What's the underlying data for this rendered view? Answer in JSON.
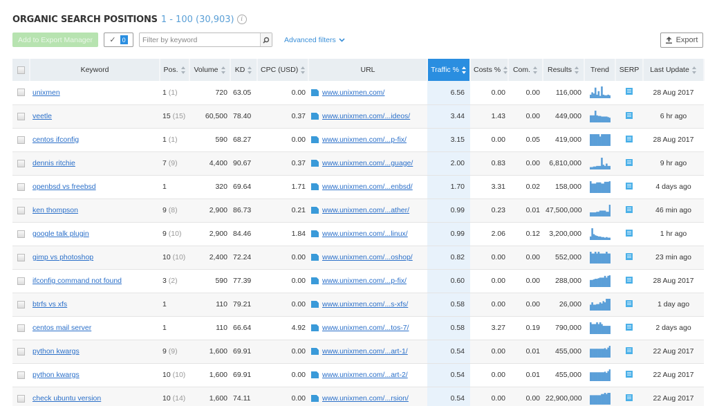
{
  "header": {
    "title": "ORGANIC SEARCH POSITIONS",
    "range": "1 - 100 (30,903)",
    "info_icon": "info-icon"
  },
  "toolbar": {
    "add_export_label": "Add to Export Manager",
    "selected_count": "0",
    "filter_placeholder": "Filter by keyword",
    "filter_value": "",
    "advanced_filters_label": "Advanced filters",
    "export_label": "Export"
  },
  "colors": {
    "accent": "#2a8ee0",
    "link": "#2a6fc9",
    "export_manager_btn": "#b7e3b0",
    "header_bg": "#e9eef2",
    "traffic_highlight": "#e8f2fb",
    "trend_bar": "#5b9fd8"
  },
  "columns": [
    {
      "key": "keyword",
      "label": "Keyword",
      "sortable": false
    },
    {
      "key": "pos",
      "label": "Pos.",
      "sortable": true
    },
    {
      "key": "volume",
      "label": "Volume",
      "sortable": true
    },
    {
      "key": "kd",
      "label": "KD",
      "sortable": true
    },
    {
      "key": "cpc",
      "label": "CPC (USD)",
      "sortable": true
    },
    {
      "key": "url",
      "label": "URL",
      "sortable": false
    },
    {
      "key": "traffic",
      "label": "Traffic %",
      "sortable": true,
      "active": true
    },
    {
      "key": "costs",
      "label": "Costs %",
      "sortable": true
    },
    {
      "key": "com",
      "label": "Com.",
      "sortable": true
    },
    {
      "key": "results",
      "label": "Results",
      "sortable": true
    },
    {
      "key": "trend",
      "label": "Trend",
      "sortable": false
    },
    {
      "key": "serp",
      "label": "SERP",
      "sortable": false
    },
    {
      "key": "last_update",
      "label": "Last Update",
      "sortable": true
    }
  ],
  "rows": [
    {
      "keyword": "unixmen",
      "pos": "1",
      "pos_prev": "(1)",
      "volume": "720",
      "kd": "63.05",
      "cpc": "0.00",
      "url": "www.unixmen.com/",
      "traffic": "6.56",
      "costs": "0.00",
      "com": "0.00",
      "results": "116,000",
      "last_update": "28 Aug 2017",
      "trend": [
        0.3,
        0.5,
        0.4,
        0.9,
        0.3,
        0.6,
        0.2,
        1.0,
        0.3,
        0.25,
        0.25,
        0.3,
        0.25
      ]
    },
    {
      "keyword": "veetle",
      "pos": "15",
      "pos_prev": "(15)",
      "volume": "60,500",
      "kd": "78.40",
      "cpc": "0.37",
      "url": "www.unixmen.com/...ideos/",
      "traffic": "3.44",
      "costs": "1.43",
      "com": "0.00",
      "results": "449,000",
      "last_update": "6 hr ago",
      "trend": [
        0.6,
        0.6,
        0.6,
        1.0,
        0.6,
        0.55,
        0.55,
        0.5,
        0.5,
        0.5,
        0.5,
        0.45,
        0.4
      ]
    },
    {
      "keyword": "centos ifconfig",
      "pos": "1",
      "pos_prev": "(1)",
      "volume": "590",
      "kd": "68.27",
      "cpc": "0.00",
      "url": "www.unixmen.com/...p-fix/",
      "traffic": "3.15",
      "costs": "0.00",
      "com": "0.05",
      "results": "419,000",
      "last_update": "28 Aug 2017",
      "trend": [
        1.0,
        1.0,
        1.0,
        1.0,
        1.0,
        1.0,
        0.8,
        1.0,
        1.0,
        1.0,
        1.0,
        1.0,
        1.0
      ]
    },
    {
      "keyword": "dennis ritchie",
      "pos": "7",
      "pos_prev": "(9)",
      "volume": "4,400",
      "kd": "90.67",
      "cpc": "0.37",
      "url": "www.unixmen.com/...guage/",
      "traffic": "2.00",
      "costs": "0.83",
      "com": "0.00",
      "results": "6,810,000",
      "last_update": "9 hr ago",
      "trend": [
        0.2,
        0.2,
        0.25,
        0.25,
        0.3,
        0.3,
        0.3,
        1.0,
        0.4,
        0.3,
        0.5,
        0.3,
        0.3
      ]
    },
    {
      "keyword": "openbsd vs freebsd",
      "pos": "1",
      "pos_prev": "",
      "volume": "320",
      "kd": "69.64",
      "cpc": "1.71",
      "url": "www.unixmen.com/...enbsd/",
      "traffic": "1.70",
      "costs": "3.31",
      "com": "0.02",
      "results": "158,000",
      "last_update": "4 days ago",
      "trend": [
        1.0,
        0.8,
        0.8,
        0.8,
        0.9,
        0.9,
        0.9,
        0.8,
        0.8,
        0.95,
        0.95,
        0.95,
        1.0
      ]
    },
    {
      "keyword": "ken thompson",
      "pos": "9",
      "pos_prev": "(8)",
      "volume": "2,900",
      "kd": "86.73",
      "cpc": "0.21",
      "url": "www.unixmen.com/...ather/",
      "traffic": "0.99",
      "costs": "0.23",
      "com": "0.01",
      "results": "47,500,000",
      "last_update": "46 min ago",
      "trend": [
        0.35,
        0.35,
        0.35,
        0.35,
        0.4,
        0.4,
        0.5,
        0.5,
        0.5,
        0.5,
        0.4,
        0.4,
        1.0
      ]
    },
    {
      "keyword": "google talk plugin",
      "pos": "9",
      "pos_prev": "(10)",
      "volume": "2,900",
      "kd": "84.46",
      "cpc": "1.84",
      "url": "www.unixmen.com/...linux/",
      "traffic": "0.99",
      "costs": "2.06",
      "com": "0.12",
      "results": "3,200,000",
      "last_update": "1 hr ago",
      "trend": [
        0.3,
        1.0,
        0.5,
        0.4,
        0.35,
        0.3,
        0.3,
        0.25,
        0.25,
        0.2,
        0.25,
        0.2,
        0.2
      ]
    },
    {
      "keyword": "gimp vs photoshop",
      "pos": "10",
      "pos_prev": "(10)",
      "volume": "2,400",
      "kd": "72.24",
      "cpc": "0.00",
      "url": "www.unixmen.com/...oshop/",
      "traffic": "0.82",
      "costs": "0.00",
      "com": "0.00",
      "results": "552,000",
      "last_update": "23 min ago",
      "trend": [
        1.0,
        0.85,
        0.85,
        1.0,
        0.85,
        1.0,
        0.85,
        0.85,
        0.85,
        0.85,
        1.0,
        0.85,
        0.85
      ]
    },
    {
      "keyword": "ifconfig command not found",
      "pos": "3",
      "pos_prev": "(2)",
      "volume": "590",
      "kd": "77.39",
      "cpc": "0.00",
      "url": "www.unixmen.com/...p-fix/",
      "traffic": "0.60",
      "costs": "0.00",
      "com": "0.00",
      "results": "288,000",
      "last_update": "28 Aug 2017",
      "trend": [
        0.6,
        0.6,
        0.65,
        0.7,
        0.7,
        0.75,
        0.8,
        0.8,
        0.8,
        0.95,
        0.8,
        0.95,
        1.0
      ]
    },
    {
      "keyword": "btrfs vs xfs",
      "pos": "1",
      "pos_prev": "",
      "volume": "110",
      "kd": "79.21",
      "cpc": "0.00",
      "url": "www.unixmen.com/...s-xfs/",
      "traffic": "0.58",
      "costs": "0.00",
      "com": "0.00",
      "results": "26,000",
      "last_update": "1 day ago",
      "trend": [
        0.5,
        0.7,
        0.5,
        0.5,
        0.55,
        0.55,
        0.7,
        0.6,
        0.8,
        0.7,
        1.0,
        1.0,
        1.0
      ]
    },
    {
      "keyword": "centos mail server",
      "pos": "1",
      "pos_prev": "",
      "volume": "110",
      "kd": "66.64",
      "cpc": "4.92",
      "url": "www.unixmen.com/...tos-7/",
      "traffic": "0.58",
      "costs": "3.27",
      "com": "0.19",
      "results": "790,000",
      "last_update": "2 days ago",
      "trend": [
        1.0,
        0.85,
        0.85,
        0.85,
        1.0,
        0.85,
        1.0,
        0.85,
        0.7,
        0.7,
        0.7,
        0.7,
        0.7
      ]
    },
    {
      "keyword": "python kwargs",
      "pos": "9",
      "pos_prev": "(9)",
      "volume": "1,600",
      "kd": "69.91",
      "cpc": "0.00",
      "url": "www.unixmen.com/...art-1/",
      "traffic": "0.54",
      "costs": "0.00",
      "com": "0.01",
      "results": "455,000",
      "last_update": "22 Aug 2017",
      "trend": [
        0.75,
        0.75,
        0.75,
        0.75,
        0.75,
        0.75,
        0.75,
        0.75,
        0.75,
        0.8,
        0.7,
        0.85,
        1.0
      ]
    },
    {
      "keyword": "python kwargs",
      "pos": "10",
      "pos_prev": "(10)",
      "volume": "1,600",
      "kd": "69.91",
      "cpc": "0.00",
      "url": "www.unixmen.com/...art-2/",
      "traffic": "0.54",
      "costs": "0.00",
      "com": "0.01",
      "results": "455,000",
      "last_update": "22 Aug 2017",
      "trend": [
        0.75,
        0.75,
        0.75,
        0.75,
        0.75,
        0.75,
        0.75,
        0.75,
        0.75,
        0.8,
        0.7,
        0.85,
        1.0
      ]
    },
    {
      "keyword": "check ubuntu version",
      "pos": "10",
      "pos_prev": "(14)",
      "volume": "1,600",
      "kd": "74.11",
      "cpc": "0.00",
      "url": "www.unixmen.com/...rsion/",
      "traffic": "0.54",
      "costs": "0.00",
      "com": "0.00",
      "results": "22,900,000",
      "last_update": "22 Aug 2017",
      "trend": [
        0.8,
        0.8,
        0.8,
        0.8,
        0.8,
        0.8,
        0.8,
        0.9,
        0.9,
        1.0,
        0.9,
        1.0,
        1.0
      ]
    }
  ]
}
